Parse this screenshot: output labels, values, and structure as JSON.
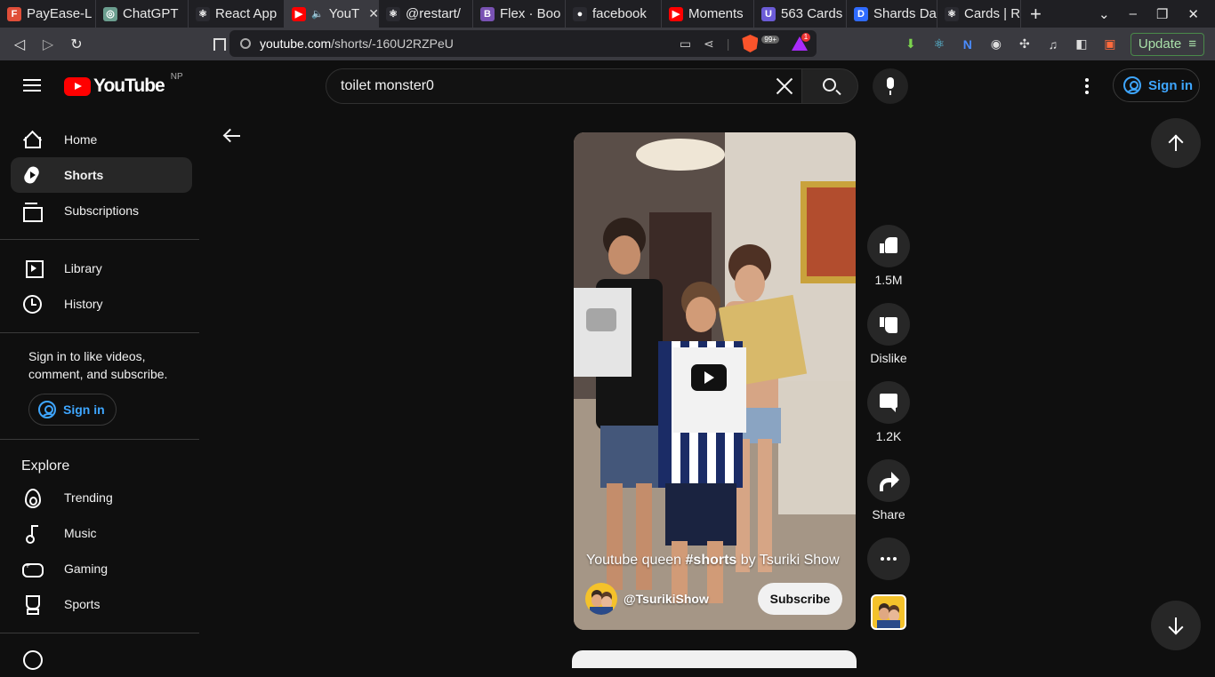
{
  "browser": {
    "tabs": [
      {
        "title": "PayEase-L",
        "fav_color": "#e04e39",
        "fav_glyph": "F"
      },
      {
        "title": "ChatGPT",
        "fav_color": "#6b9e8f",
        "fav_glyph": "◎"
      },
      {
        "title": "React App",
        "fav_color": "#2a2a30",
        "fav_glyph": "⚛"
      },
      {
        "title": "YouT",
        "fav_color": "#ff0000",
        "fav_glyph": "▶",
        "active": true,
        "audio": "🔈"
      },
      {
        "title": "@restart/",
        "fav_color": "#2a2a30",
        "fav_glyph": "⚛"
      },
      {
        "title": "Flex · Boo",
        "fav_color": "#7952b3",
        "fav_glyph": "B"
      },
      {
        "title": "facebook",
        "fav_color": "#2a2a30",
        "fav_glyph": "●"
      },
      {
        "title": "Moments",
        "fav_color": "#ff0000",
        "fav_glyph": "▶"
      },
      {
        "title": "563 Cards",
        "fav_color": "#6b5bd6",
        "fav_glyph": "U"
      },
      {
        "title": "Shards Da",
        "fav_color": "#2f6bff",
        "fav_glyph": "D"
      },
      {
        "title": "Cards | Re",
        "fav_color": "#2a2a30",
        "fav_glyph": "⚛"
      }
    ],
    "tab_close": "✕",
    "new_tab": "+",
    "url_domain": "youtube.com",
    "url_path": "/shorts/-160U2RZPeU",
    "brave_badge": "99+",
    "update_label": "Update",
    "update_menu": "≡"
  },
  "youtube": {
    "logo_text": "YouTube",
    "country_code": "NP",
    "search_query": "toilet monster0",
    "signin_label": "Sign in",
    "sidebar": {
      "primary": [
        {
          "label": "Home",
          "icon": "home-icon"
        },
        {
          "label": "Shorts",
          "icon": "shorts-icon",
          "active": true
        },
        {
          "label": "Subscriptions",
          "icon": "subscriptions-icon"
        }
      ],
      "secondary": [
        {
          "label": "Library",
          "icon": "library-icon"
        },
        {
          "label": "History",
          "icon": "history-icon"
        }
      ],
      "signin_note": "Sign in to like videos, comment, and subscribe.",
      "signin_label": "Sign in",
      "explore_title": "Explore",
      "explore": [
        {
          "label": "Trending",
          "icon": "trending-icon"
        },
        {
          "label": "Music",
          "icon": "music-icon"
        },
        {
          "label": "Gaming",
          "icon": "gaming-icon"
        },
        {
          "label": "Sports",
          "icon": "sports-icon"
        }
      ]
    },
    "short": {
      "title_pre": "Youtube queen ",
      "title_tag": "#shorts",
      "title_post": " by Tsuriki Show",
      "channel": "@TsurikiShow",
      "subscribe_label": "Subscribe",
      "likes": "1.5M",
      "dislike_label": "Dislike",
      "comments": "1.2K",
      "share_label": "Share"
    }
  }
}
